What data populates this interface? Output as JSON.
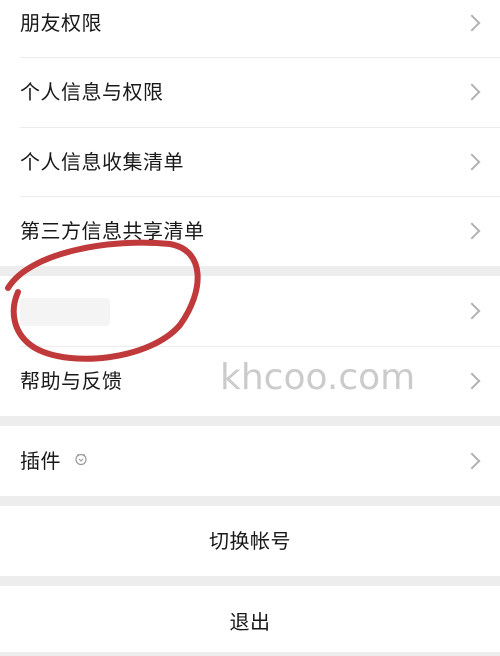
{
  "settings": {
    "group1": [
      {
        "label": "朋友权限"
      },
      {
        "label": "个人信息与权限"
      },
      {
        "label": "个人信息收集清单"
      },
      {
        "label": "第三方信息共享清单"
      }
    ],
    "group2": [
      {
        "label": ""
      },
      {
        "label": "帮助与反馈"
      }
    ],
    "plugins": {
      "label": "插件"
    },
    "switch_account": "切换帐号",
    "logout": "退出"
  },
  "overlay": {
    "watermark": "khcoo.com",
    "annotation_color": "#c0393b"
  },
  "icons": {
    "chevron": "chevron-right-icon",
    "plugin": "plugin-badge-icon"
  }
}
